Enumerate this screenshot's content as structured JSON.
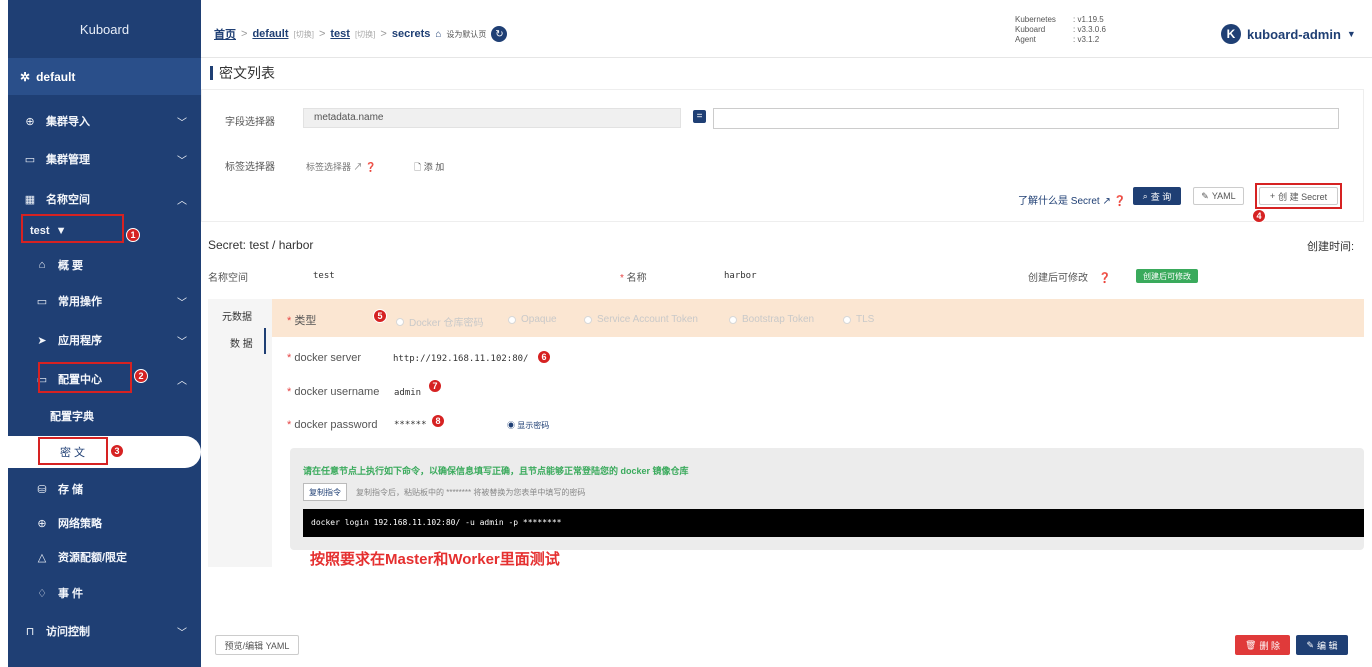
{
  "sidebar": {
    "app_title": "Kuboard",
    "cluster": "default",
    "items": {
      "import": "集群导入",
      "manage": "集群管理",
      "namespace": "名称空间",
      "ns_select": "test",
      "overview": "概 要",
      "common_ops": "常用操作",
      "apps": "应用程序",
      "config_center": "配置中心",
      "config_dict": "配置字典",
      "secrets": "密 文",
      "storage": "存 储",
      "network_policy": "网络策略",
      "quota": "资源配额/限定",
      "events": "事 件",
      "access_control": "访问控制"
    }
  },
  "topbar": {
    "crumb_home": "首页",
    "crumb_default": "default",
    "crumb_switch": "[切换]",
    "crumb_test": "test",
    "crumb_secrets": "secrets",
    "set_default": "设为默认页",
    "versions": [
      {
        "k": "Kubernetes",
        "v": ": v1.19.5"
      },
      {
        "k": "Kuboard",
        "v": ": v3.3.0.6"
      },
      {
        "k": "Agent",
        "v": ": v3.1.2"
      }
    ],
    "user": "kuboard-admin"
  },
  "list": {
    "title": "密文列表",
    "field_selector_label": "字段选择器",
    "field_selector_value": "metadata.name",
    "eq": "=",
    "label_selector_label": "标签选择器",
    "label_selector_link": "标签选择器",
    "add": "添 加",
    "learn": "了解什么是 Secret",
    "query": "查 询",
    "yaml": "YAML",
    "create": "创 建 Secret"
  },
  "detail": {
    "title": "Secret: test / harbor",
    "created_label": "创建时间:",
    "ns_label": "名称空间",
    "ns_value": "test",
    "name_label": "名称",
    "name_value": "harbor",
    "editable_label": "创建后可修改",
    "editable_badge": "创建后可修改",
    "tab_meta": "元数据",
    "tab_data": "数 据",
    "type_label": "类型",
    "types": [
      "Docker 仓库密码",
      "Opaque",
      "Service Account Token",
      "Bootstrap Token",
      "TLS"
    ],
    "server_label": "docker server",
    "server_value": "http://192.168.11.102:80/",
    "username_label": "docker username",
    "username_value": "admin",
    "password_label": "docker password",
    "password_value": "******",
    "show_password": "显示密码",
    "cmd_title": "请在任意节点上执行如下命令，以确保信息填写正确，且节点能够正常登陆您的 docker 镜像仓库",
    "copy_btn": "复制指令",
    "copy_hint": "复制指令后，粘贴板中的 ******** 将被替换为您表单中填写的密码",
    "command": "docker login 192.168.11.102:80/ -u admin -p ********",
    "annotation": "按照要求在Master和Worker里面测试"
  },
  "footer": {
    "preview_yaml": "预览/编辑 YAML",
    "delete": "删 除",
    "edit": "编 辑"
  },
  "badges": [
    "1",
    "2",
    "3",
    "4",
    "5",
    "6",
    "7",
    "8"
  ],
  "colors": {
    "sidebar": "#1f3f74",
    "accent": "#1f3f74",
    "annotation": "#e53030",
    "type_row": "#fbe6d2",
    "success": "#3aaa5c"
  }
}
